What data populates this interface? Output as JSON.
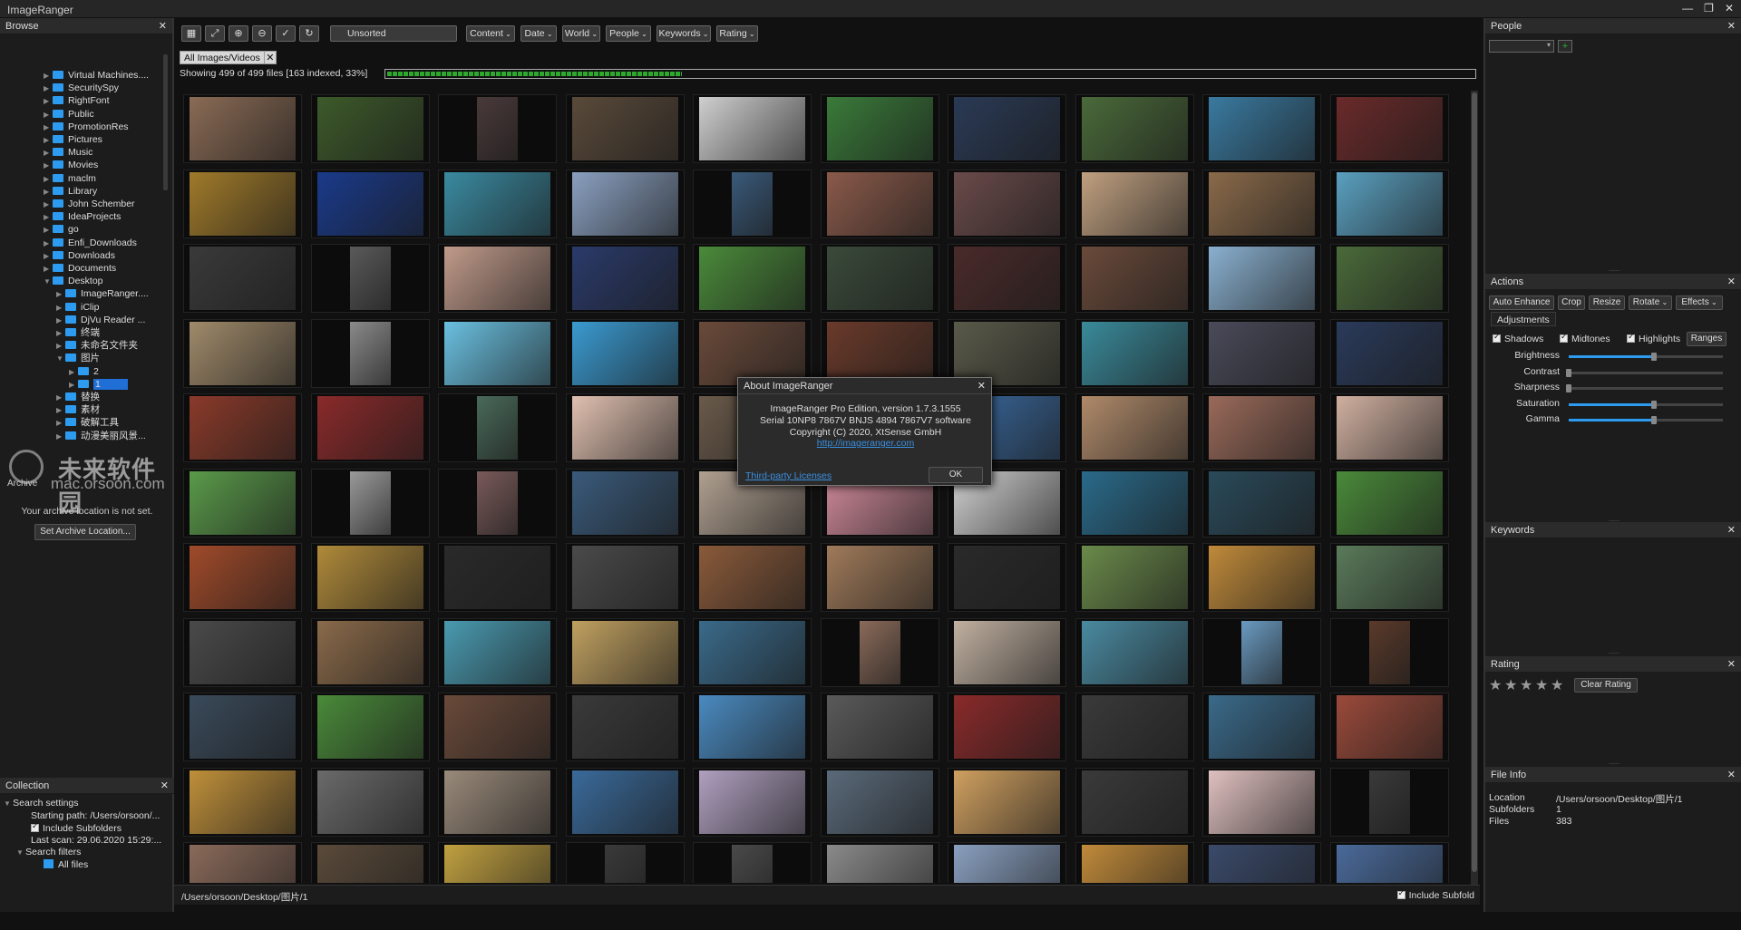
{
  "app": {
    "title": "ImageRanger"
  },
  "browse": {
    "title": "Browse",
    "tree": [
      {
        "label": "Virtual Machines....",
        "depth": 0
      },
      {
        "label": "SecuritySpy",
        "depth": 0
      },
      {
        "label": "RightFont",
        "depth": 0
      },
      {
        "label": "Public",
        "depth": 0
      },
      {
        "label": "PromotionRes",
        "depth": 0
      },
      {
        "label": "Pictures",
        "depth": 0
      },
      {
        "label": "Music",
        "depth": 0
      },
      {
        "label": "Movies",
        "depth": 0
      },
      {
        "label": "maclm",
        "depth": 0
      },
      {
        "label": "Library",
        "depth": 0
      },
      {
        "label": "John Schember",
        "depth": 0
      },
      {
        "label": "IdeaProjects",
        "depth": 0
      },
      {
        "label": "go",
        "depth": 0
      },
      {
        "label": "Enfi_Downloads",
        "depth": 0
      },
      {
        "label": "Downloads",
        "depth": 0
      },
      {
        "label": "Documents",
        "depth": 0
      },
      {
        "label": "Desktop",
        "depth": 0,
        "open": true
      },
      {
        "label": "ImageRanger....",
        "depth": 1
      },
      {
        "label": "iClip",
        "depth": 1
      },
      {
        "label": "DjVu Reader ...",
        "depth": 1
      },
      {
        "label": "终端",
        "depth": 1
      },
      {
        "label": "未命名文件夹",
        "depth": 1
      },
      {
        "label": "图片",
        "depth": 1,
        "open": true
      },
      {
        "label": "2",
        "depth": 2
      },
      {
        "label": "1",
        "depth": 2,
        "selected": true
      },
      {
        "label": "替换",
        "depth": 1
      },
      {
        "label": "素材",
        "depth": 1
      },
      {
        "label": "破解工具",
        "depth": 1
      },
      {
        "label": "动漫美丽风景...",
        "depth": 1
      }
    ]
  },
  "watermark": {
    "line1": "未来软件园",
    "line2": "mac.orsoon.com"
  },
  "archive": {
    "title": "Archive",
    "message": "Your archive location is not set.",
    "button": "Set Archive Location..."
  },
  "collection": {
    "title": "Collection",
    "search_settings": "Search settings",
    "starting_path": "Starting path: /Users/orsoon/...",
    "include_subfolders": "Include Subfolders",
    "last_scan": "Last scan: 29.06.2020 15:29:...",
    "search_filters": "Search filters",
    "all_files": "All files"
  },
  "toolbar": {
    "sort": "Unsorted",
    "filters": [
      "Content",
      "Date",
      "World",
      "People",
      "Keywords",
      "Rating"
    ]
  },
  "tabs": [
    {
      "label": "All Images/Videos"
    }
  ],
  "status": {
    "text": "Showing 499 of 499 files [163 indexed, 33%]",
    "progress": 0.27
  },
  "bottom": {
    "path": "/Users/orsoon/Desktop/图片/1",
    "include_subfolders": "Include Subfold"
  },
  "people": {
    "title": "People",
    "add": "+"
  },
  "actions": {
    "title": "Actions",
    "buttons": [
      "Auto Enhance",
      "Crop",
      "Resize",
      "Rotate",
      "Effects"
    ],
    "adjustments_tab": "Adjustments",
    "checks": [
      "Shadows",
      "Midtones",
      "Highlights"
    ],
    "ranges": "Ranges",
    "sliders": [
      {
        "label": "Brightness",
        "value": 0.55
      },
      {
        "label": "Contrast",
        "value": 0.0
      },
      {
        "label": "Sharpness",
        "value": 0.0
      },
      {
        "label": "Saturation",
        "value": 0.55
      },
      {
        "label": "Gamma",
        "value": 0.55
      }
    ]
  },
  "keywords": {
    "title": "Keywords"
  },
  "rating": {
    "title": "Rating",
    "stars": 5,
    "clear": "Clear Rating"
  },
  "file_info": {
    "title": "File Info",
    "rows": [
      {
        "k": "Location",
        "v": "/Users/orsoon/Desktop/图片/1"
      },
      {
        "k": "Subfolders",
        "v": "1"
      },
      {
        "k": "Files",
        "v": "383"
      }
    ]
  },
  "about": {
    "title": "About ImageRanger",
    "line1": "ImageRanger Pro Edition, version 1.7.3.1555",
    "line2": "Serial 10NP8 7867V BNJS 4894 7867V7 software",
    "line3": "Copyright (C) 2020, XtSense GmbH",
    "url": "http://imageranger.com",
    "licenses": "Third-party Licenses",
    "ok": "OK"
  },
  "palette": {
    "accent": "#2d9cf0",
    "progress": "#2ea82e",
    "thumbs": [
      "#8a6b55",
      "#3d5a2a",
      "#4a3a3a",
      "#5a4a3a",
      "#cfcfcf",
      "#3a7a3a",
      "#2a3a55",
      "#4a6a3a",
      "#3a7aa0",
      "#6a2a2a",
      "#a07a2a",
      "#1a3a8a",
      "#3a8aa0",
      "#8aa0c0",
      "#3a5a7a",
      "#8a5a4a",
      "#6a4a4a",
      "#c0a080",
      "#8a6a4a",
      "#5aa0c0",
      "#3a3a3a",
      "#5a5a5a",
      "#c09a8a",
      "#2a3a6a",
      "#4a8a3a",
      "#3a4a3a",
      "#4a2a2a",
      "#6a4a3a",
      "#8ab0d0",
      "#4a6a3a",
      "#a08a6a",
      "#8a8a8a",
      "#6ac0e0",
      "#3a9ad0",
      "#6a4a3a",
      "#6a3a2a",
      "#5a5a4a",
      "#3a8a9a",
      "#4a4a5a",
      "#2a3a5a",
      "#8a3a2a",
      "#8a2a2a",
      "#4a6a5a",
      "#e0c0b0",
      "#6a5a4a",
      "#4a4a3a",
      "#3a6aa0",
      "#b08a6a",
      "#9a6a5a",
      "#d0b0a0",
      "#5a9a4a",
      "#9a9a9a",
      "#7a5a5a",
      "#3a5a7a",
      "#b0a090",
      "#d08a9a",
      "#d0d0d0",
      "#2a6a8a",
      "#2a4a5a",
      "#4a8a3a",
      "#a04a2a",
      "#b08a3a",
      "#2a2a2a",
      "#4a4a4a",
      "#8a5a3a",
      "#a07a5a",
      "#2a2a2a",
      "#6a8a4a",
      "#c08a3a",
      "#5a7a5a",
      "#4a4a4a",
      "#8a6a4a",
      "#4a9ab0",
      "#c0a060",
      "#3a6a8a",
      "#8a6a5a",
      "#c0b0a0",
      "#4a8aa0",
      "#6a9ac0",
      "#5a3a2a",
      "#3a4a5a",
      "#4a8a3a",
      "#6a4a3a",
      "#3a3a3a",
      "#4a8ac0",
      "#5a5a5a",
      "#8a2a2a",
      "#3a3a3a",
      "#3a6a8a",
      "#9a4a3a",
      "#c0903a",
      "#6a6a6a",
      "#9a8a7a",
      "#3a6a9a",
      "#b0a0c0",
      "#5a6a7a",
      "#d0a060",
      "#3a3a3a",
      "#e0c0c0",
      "#3a3a3a",
      "#8a6a5a",
      "#5a4a3a",
      "#c0a040",
      "#3a3a3a",
      "#4a4a4a",
      "#8a8a8a",
      "#8aa0c0",
      "#c08a3a",
      "#3a4a6a",
      "#4a6a9a"
    ],
    "aspects": [
      "w",
      "w",
      "n",
      "w",
      "w",
      "w",
      "w",
      "w",
      "w",
      "w",
      "w",
      "w",
      "w",
      "w",
      "n",
      "w",
      "w",
      "w",
      "w",
      "w",
      "w",
      "n",
      "w",
      "w",
      "w",
      "w",
      "w",
      "w",
      "w",
      "w",
      "w",
      "n",
      "w",
      "w",
      "w",
      "w",
      "w",
      "w",
      "w",
      "w",
      "w",
      "w",
      "n",
      "w",
      "w",
      "w",
      "w",
      "w",
      "w",
      "w",
      "w",
      "n",
      "n",
      "w",
      "w",
      "w",
      "w",
      "w",
      "w",
      "w",
      "w",
      "w",
      "w",
      "w",
      "w",
      "w",
      "w",
      "w",
      "w",
      "w",
      "w",
      "w",
      "w",
      "w",
      "w",
      "n",
      "w",
      "w",
      "n",
      "n",
      "w",
      "w",
      "w",
      "w",
      "w",
      "w",
      "w",
      "w",
      "w",
      "w",
      "w",
      "w",
      "w",
      "w",
      "w",
      "w",
      "w",
      "w",
      "w",
      "n",
      "w",
      "w",
      "w",
      "n",
      "n",
      "w",
      "w",
      "w",
      "w",
      "w"
    ]
  }
}
